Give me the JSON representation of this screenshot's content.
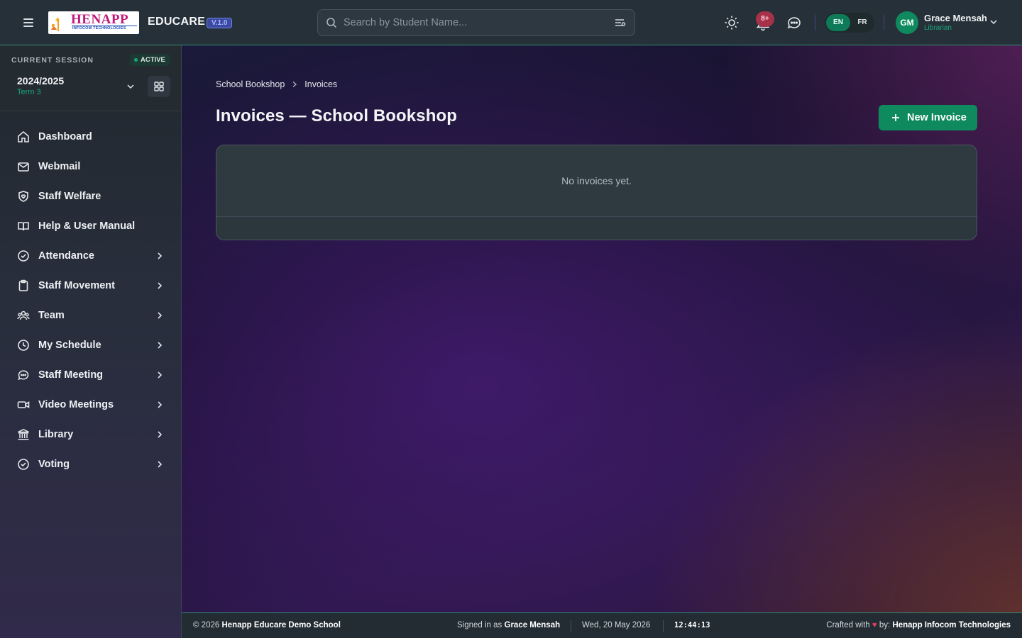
{
  "app": {
    "logo_text": "HENAPP",
    "logo_subtext": "INFOCOM TECHNOLOGIES",
    "name": "EDUCARE",
    "version": "V.1.0"
  },
  "header": {
    "search_placeholder": "Search by Student Name...",
    "search_value": "",
    "notifications_badge": "8+",
    "languages": [
      "EN",
      "FR"
    ],
    "active_language": "EN",
    "user": {
      "initials": "GM",
      "name": "Grace Mensah",
      "role": "Librarian"
    }
  },
  "session": {
    "label": "CURRENT SESSION",
    "status": "ACTIVE",
    "year": "2024/2025",
    "term": "Term 3"
  },
  "sidebar": {
    "items": [
      {
        "label": "Dashboard",
        "icon": "home-icon",
        "has_submenu": false
      },
      {
        "label": "Webmail",
        "icon": "mail-icon",
        "has_submenu": false
      },
      {
        "label": "Staff Welfare",
        "icon": "shield-heart-icon",
        "has_submenu": false
      },
      {
        "label": "Help & User Manual",
        "icon": "book-open-icon",
        "has_submenu": false
      },
      {
        "label": "Attendance",
        "icon": "check-circle-icon",
        "has_submenu": true
      },
      {
        "label": "Staff Movement",
        "icon": "clipboard-icon",
        "has_submenu": true
      },
      {
        "label": "Team",
        "icon": "users-icon",
        "has_submenu": true
      },
      {
        "label": "My Schedule",
        "icon": "clock-icon",
        "has_submenu": true
      },
      {
        "label": "Staff Meeting",
        "icon": "chat-bubble-icon",
        "has_submenu": true
      },
      {
        "label": "Video Meetings",
        "icon": "video-icon",
        "has_submenu": true
      },
      {
        "label": "Library",
        "icon": "library-icon",
        "has_submenu": true
      },
      {
        "label": "Voting",
        "icon": "check-circle-icon",
        "has_submenu": true
      }
    ]
  },
  "main": {
    "breadcrumb": [
      "School Bookshop",
      "Invoices"
    ],
    "title": "Invoices — School Bookshop",
    "new_button_label": "New Invoice",
    "empty_message": "No invoices yet."
  },
  "footer": {
    "copyright_prefix": "© 2026",
    "school_name": "Henapp Educare Demo School",
    "signed_in_prefix": "Signed in as",
    "signed_in_user": "Grace Mensah",
    "date": "Wed, 20 May 2026",
    "time": "12:44:13",
    "crafted_prefix": "Crafted with",
    "crafted_middle": "by:",
    "crafted_by": "Henapp Infocom Technologies"
  },
  "colors": {
    "accent_green": "#0f8a5f",
    "term_green": "#1aa57c",
    "version_badge": "#3b4aa0",
    "notification_red": "#a8314a",
    "heart_red": "#e0405b"
  }
}
